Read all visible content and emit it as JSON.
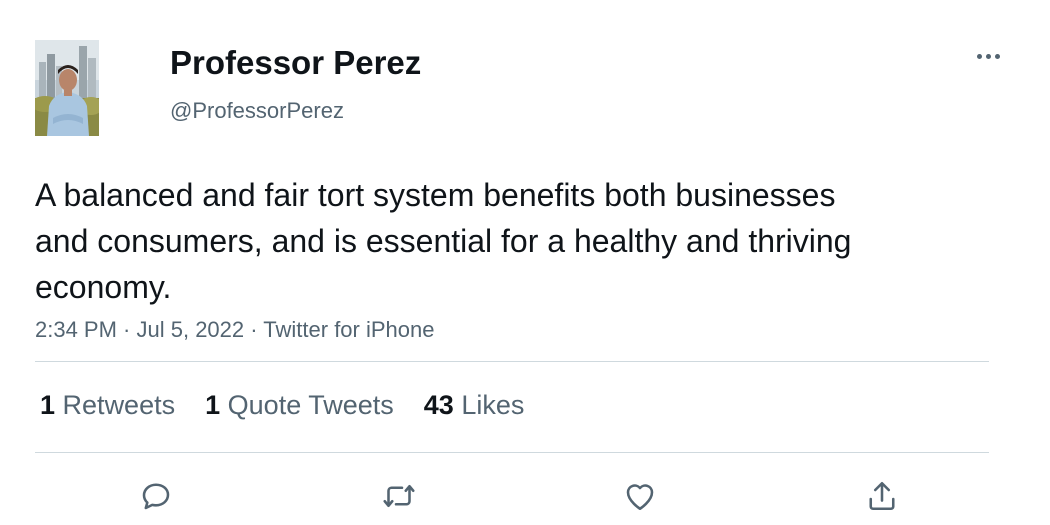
{
  "author": {
    "display_name": "Professor Perez",
    "handle": "@ProfessorPerez"
  },
  "tweet": {
    "text": "A balanced and fair tort system benefits both businesses and consumers, and is essential for a healthy and thriving economy.",
    "time": "2:34 PM",
    "date": "Jul 5, 2022",
    "source": "Twitter for iPhone",
    "separator": " · "
  },
  "stats": {
    "retweets_count": "1",
    "retweets_label": "Retweets",
    "quotes_count": "1",
    "quotes_label": "Quote Tweets",
    "likes_count": "43",
    "likes_label": "Likes"
  },
  "icons": {
    "more": "more-horizontal-icon",
    "reply": "reply-icon",
    "retweet": "retweet-icon",
    "like": "heart-icon",
    "share": "share-icon"
  },
  "colors": {
    "text_primary": "#0f1419",
    "text_secondary": "#536471",
    "divider": "#cfd9de"
  }
}
